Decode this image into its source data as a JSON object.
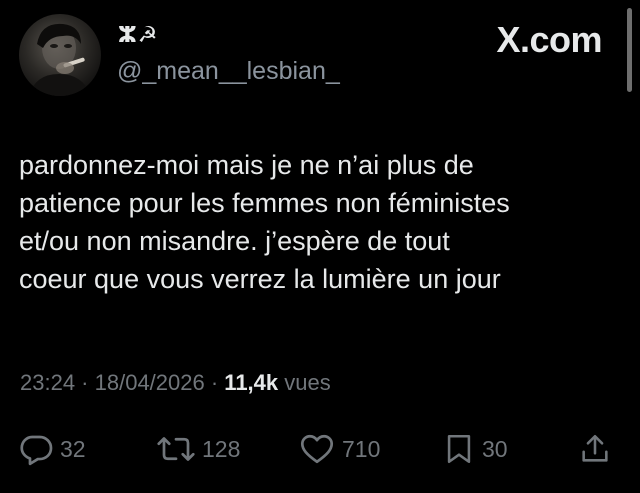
{
  "author": {
    "display_name": "ⵣ☭",
    "handle": "@_mean__lesbian_"
  },
  "watermark": "X.com",
  "tweet": {
    "text": "pardonnez-moi mais je ne n’ai plus de\npatience pour les femmes non féministes\net/ou non misandre. j’espère de tout\ncoeur que vous verrez la lumière un jour"
  },
  "meta": {
    "time": "23:24",
    "separator": " · ",
    "date": "18/04/2026",
    "views_count": "11,4k",
    "views_label": " vues"
  },
  "actions": {
    "replies": "32",
    "retweets": "128",
    "likes": "710",
    "bookmarks": "30"
  },
  "icons": {
    "reply": "speech-bubble",
    "retweet": "retweet-arrows",
    "like": "heart-outline",
    "bookmark": "bookmark-outline",
    "share": "share-upload"
  }
}
